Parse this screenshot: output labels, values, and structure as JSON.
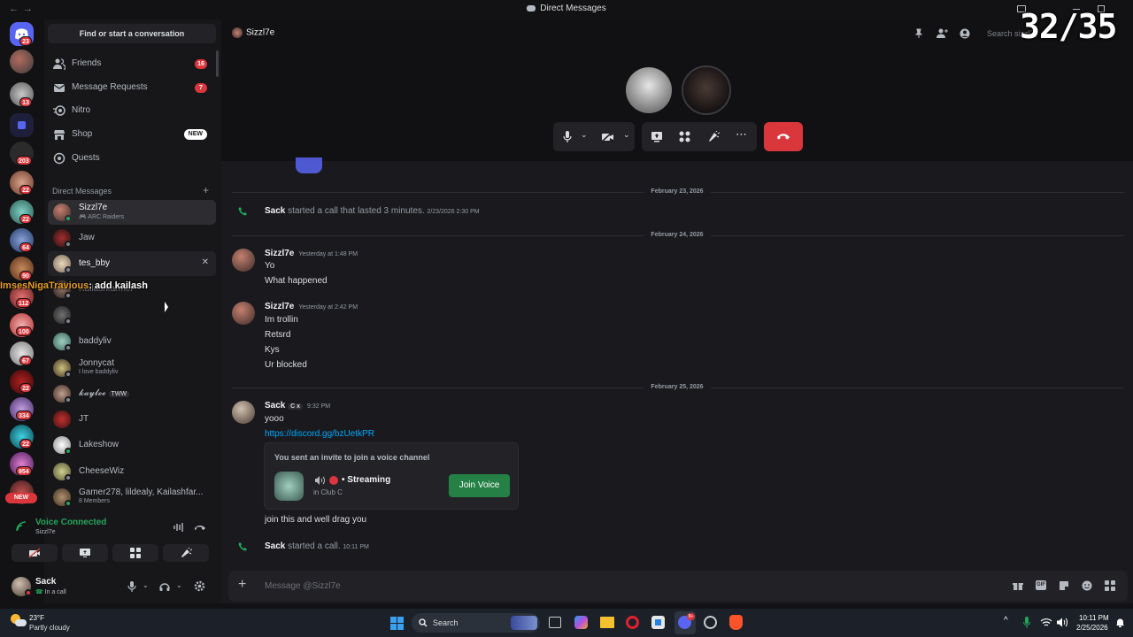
{
  "titlebar": {
    "title": "Direct Messages",
    "back": "←",
    "forward": "→"
  },
  "rail_badges": [
    "23",
    "13",
    "203",
    "22",
    "22",
    "64",
    "90",
    "112",
    "100",
    "67",
    "22",
    "334",
    "22",
    "954"
  ],
  "rail_new": "NEW",
  "sidebar": {
    "search_label": "Find or start a conversation",
    "nav": [
      {
        "label": "Friends",
        "badge": "16"
      },
      {
        "label": "Message Requests",
        "badge": "7"
      },
      {
        "label": "Nitro",
        "badge": ""
      },
      {
        "label": "Shop",
        "badge": "NEW"
      },
      {
        "label": "Quests",
        "badge": ""
      }
    ],
    "dm_header": "Direct Messages",
    "dm_plus": "+",
    "dms": [
      {
        "name": "Sizzl7e",
        "sub": "🎮 ARC Raiders"
      },
      {
        "name": "Jaw",
        "sub": ""
      },
      {
        "name": "tes_bby",
        "sub": ""
      },
      {
        "name": "Kailashfarmer",
        "sub": ""
      },
      {
        "name": "",
        "sub": ""
      },
      {
        "name": "baddyliv",
        "sub": ""
      },
      {
        "name": "Jonnycat",
        "sub": "I love baddyliv"
      },
      {
        "name": "𝓴𝓪𝔂𝓵𝓮𝓮",
        "sub": "",
        "tag": "TWW"
      },
      {
        "name": "JT",
        "sub": ""
      },
      {
        "name": "Lakeshow",
        "sub": ""
      },
      {
        "name": "CheeseWiz",
        "sub": ""
      },
      {
        "name": "Gamer278, lildealy, Kailashfar...",
        "sub": "8 Members"
      }
    ],
    "close_x": "✕"
  },
  "voice": {
    "status": "Voice Connected",
    "channel": "Sizzl7e"
  },
  "user": {
    "name": "Sack",
    "status": "In a call"
  },
  "overlay": {
    "user": "ImsesNigaTravious",
    "text": ": add kailash"
  },
  "counter": "32/35",
  "channel": {
    "name": "Sizzl7e",
    "search_placeholder": "Search sizzl7e"
  },
  "messages": {
    "sep1": "February 23, 2026",
    "call1_user": "Sack",
    "call1_text": " started a call that lasted 3 minutes. ",
    "call1_ts": "2/23/2026 2:30 PM",
    "sep2": "February 24, 2026",
    "g1_author": "Sizzl7e",
    "g1_ts": "Yesterday at 1:48 PM",
    "g1_lines": [
      "Yo",
      "What happened"
    ],
    "g2_author": "Sizzl7e",
    "g2_ts": "Yesterday at 2:42 PM",
    "g2_lines": [
      "Im trollin",
      "Retsrd",
      "Kys",
      "Ur blocked"
    ],
    "sep3": "February 25, 2026",
    "g3_author": "Sack",
    "g3_tag": "C x",
    "g3_ts": "9:32 PM",
    "g3_line1": "yooo",
    "g3_link": "https://discord.gg/bzUetkPR",
    "invite_title": "You sent an invite to join a voice channel",
    "invite_name": "• Streaming",
    "invite_sub": "in Club C",
    "invite_button": "Join Voice",
    "g3_line2": "join this and well drag you",
    "call2_user": "Sack",
    "call2_text": " started a call. ",
    "call2_ts": "10:11 PM"
  },
  "composer": {
    "placeholder": "Message @Sizzl7e"
  },
  "taskbar": {
    "weather_temp": "23°F",
    "weather_desc": "Partly cloudy",
    "search": "Search",
    "time": "10:11 PM",
    "date": "2/25/2026",
    "discord_badge": "9+"
  },
  "colors": {
    "accent": "#5865f2",
    "green": "#23a55a",
    "red": "#da373c",
    "link": "#00a8fc"
  }
}
